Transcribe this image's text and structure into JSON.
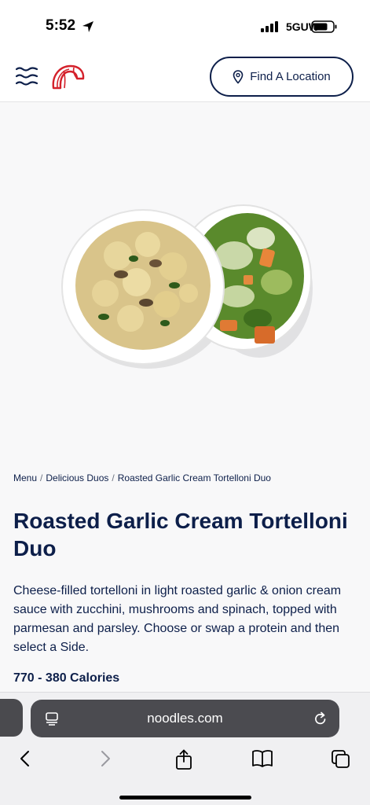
{
  "status_bar": {
    "time": "5:52",
    "network": "5GUW"
  },
  "header": {
    "find_location_label": "Find A Location"
  },
  "breadcrumb": [
    "Menu",
    "Delicious Duos",
    "Roasted Garlic Cream Tortelloni Duo"
  ],
  "product": {
    "title": "Roasted Garlic Cream Tortelloni Duo",
    "description": "Cheese-filled tortelloni in light roasted garlic & onion cream sauce with zucchini, mushrooms and spinach, topped with parmesan and parsley. Choose or swap a protein and then select a Side.",
    "calories": "770 - 380 Calories"
  },
  "browser": {
    "url": "noodles.com"
  },
  "colors": {
    "brand_navy": "#0d1f4a",
    "brand_red": "#d4212b"
  }
}
